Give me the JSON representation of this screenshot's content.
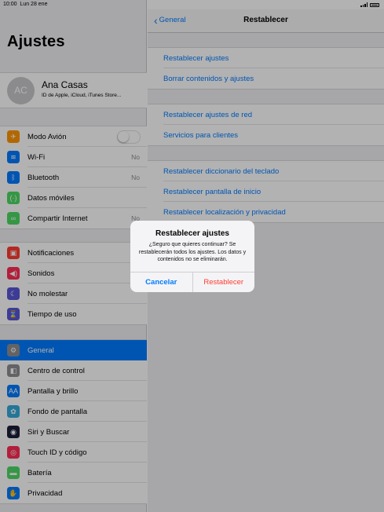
{
  "status": {
    "time": "10:00",
    "date": "Lun 28 ene"
  },
  "sidebar": {
    "title": "Ajustes",
    "profile": {
      "initials": "AC",
      "name": "Ana Casas",
      "subtitle": "ID de Apple, iCloud, iTunes Store..."
    },
    "group1": [
      {
        "label": "Modo Avión",
        "icon": "airplane-icon",
        "color": "#ff9500",
        "glyph": "✈"
      },
      {
        "label": "Wi-Fi",
        "value": "No",
        "icon": "wifi-icon",
        "color": "#007aff",
        "glyph": "≋"
      },
      {
        "label": "Bluetooth",
        "value": "No",
        "icon": "bluetooth-icon",
        "color": "#007aff",
        "glyph": "ᛒ"
      },
      {
        "label": "Datos móviles",
        "icon": "cellular-icon",
        "color": "#4cd964",
        "glyph": "(·)"
      },
      {
        "label": "Compartir Internet",
        "value": "No",
        "icon": "hotspot-icon",
        "color": "#4cd964",
        "glyph": "∞"
      }
    ],
    "group2": [
      {
        "label": "Notificaciones",
        "icon": "notifications-icon",
        "color": "#ff3b30",
        "glyph": "▣"
      },
      {
        "label": "Sonidos",
        "icon": "sounds-icon",
        "color": "#ff2d55",
        "glyph": "◀)"
      },
      {
        "label": "No molestar",
        "icon": "moon-icon",
        "color": "#5856d6",
        "glyph": "☾"
      },
      {
        "label": "Tiempo de uso",
        "icon": "hourglass-icon",
        "color": "#5856d6",
        "glyph": "⌛"
      }
    ],
    "group3": [
      {
        "label": "General",
        "icon": "gear-icon",
        "color": "#8e8e93",
        "glyph": "⚙",
        "selected": true
      },
      {
        "label": "Centro de control",
        "icon": "control-center-icon",
        "color": "#8e8e93",
        "glyph": "◧"
      },
      {
        "label": "Pantalla y brillo",
        "icon": "display-icon",
        "color": "#007aff",
        "glyph": "AA"
      },
      {
        "label": "Fondo de pantalla",
        "icon": "wallpaper-icon",
        "color": "#34aadc",
        "glyph": "✿"
      },
      {
        "label": "Siri y Buscar",
        "icon": "siri-icon",
        "color": "#1c1c3a",
        "glyph": "◉"
      },
      {
        "label": "Touch ID y código",
        "icon": "fingerprint-icon",
        "color": "#ff2d55",
        "glyph": "◎"
      },
      {
        "label": "Batería",
        "icon": "battery-icon",
        "color": "#4cd964",
        "glyph": "▬"
      },
      {
        "label": "Privacidad",
        "icon": "hand-icon",
        "color": "#007aff",
        "glyph": "✋"
      }
    ]
  },
  "navbar": {
    "back_label": "General",
    "title": "Restablecer"
  },
  "main": {
    "group1": [
      "Restablecer ajustes",
      "Borrar contenidos y ajustes"
    ],
    "group2": [
      "Restablecer ajustes de red",
      "Servicios para clientes"
    ],
    "group3": [
      "Restablecer diccionario del teclado",
      "Restablecer pantalla de inicio",
      "Restablecer localización y privacidad"
    ]
  },
  "alert": {
    "title": "Restablecer ajustes",
    "message": "¿Seguro que quieres continuar? Se restablecerán todos los ajustes. Los datos y contenidos no se eliminarán.",
    "cancel": "Cancelar",
    "confirm": "Restablecer"
  }
}
